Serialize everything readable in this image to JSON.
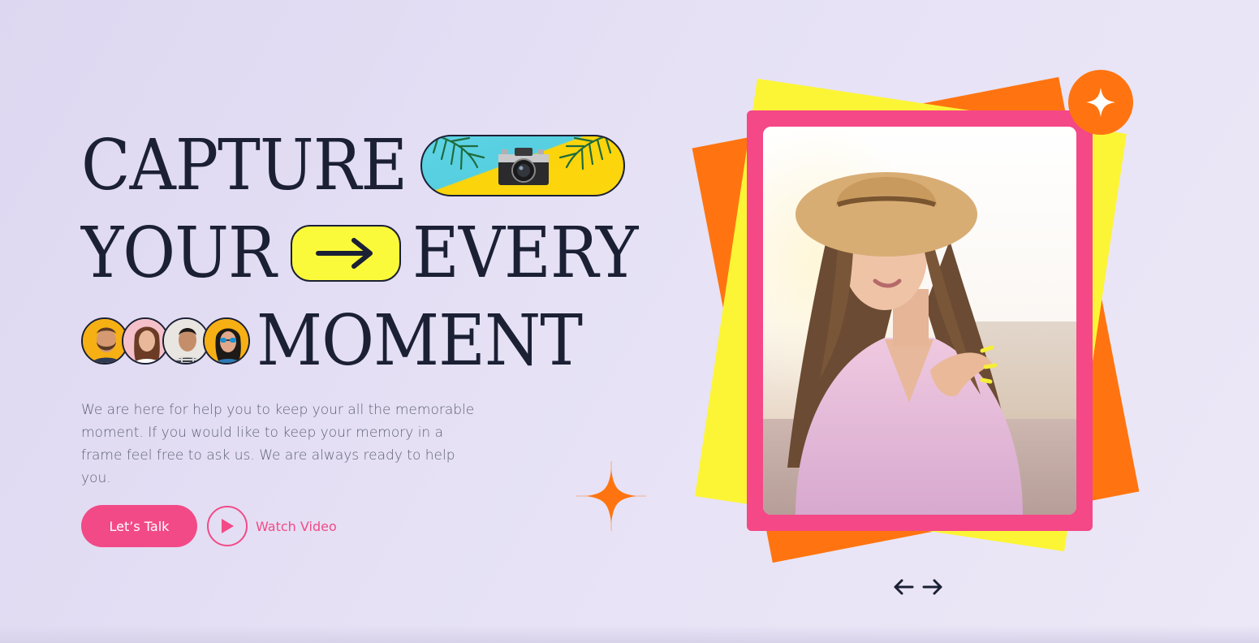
{
  "hero": {
    "headline": {
      "line1": "CAPTURE",
      "line2_a": "YOUR",
      "line2_b": "EVERY",
      "line3": "MOMENT"
    },
    "description": "We are here for help you to keep your all the memorable moment. If you would like to keep your memory in a frame feel free to ask us. We are always ready to help you.",
    "cta": {
      "talk_label": "Let’s Talk",
      "video_label": "Watch Video"
    }
  },
  "decor": {
    "camera_pill_icon": "camera-icon",
    "arrow_pill_icon": "arrow-right-icon",
    "avatars": [
      "avatar-man-beard",
      "avatar-woman-smile",
      "avatar-man-plaid",
      "avatar-woman-sunglasses"
    ]
  },
  "gallery": {
    "badge_icon": "sparkle-icon",
    "prev_icon": "arrow-left-icon",
    "next_icon": "arrow-right-icon"
  },
  "colors": {
    "accent_pink": "#f24a87",
    "accent_orange": "#ff7410",
    "accent_yellow": "#fcf536",
    "text_dark": "#1b2035",
    "background": "#e4dff4"
  }
}
